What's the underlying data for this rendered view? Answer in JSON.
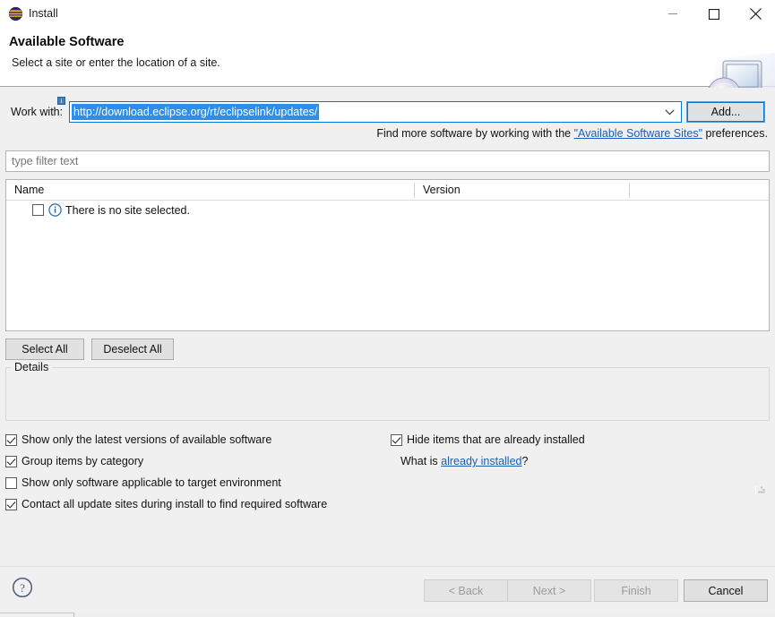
{
  "window": {
    "title": "Install",
    "icon": "eclipse-icon",
    "controls": {
      "minimize": "minimize-icon",
      "maximize": "maximize-icon",
      "close": "close-icon"
    }
  },
  "banner": {
    "title": "Available Software",
    "subtitle": "Select a site or enter the location of a site.",
    "graphic": "install-monitor-disc-graphic"
  },
  "work_with": {
    "label": "Work with:",
    "value": "http://download.eclipse.org/rt/eclipselink/updates/",
    "selected": true,
    "add_button": "Add...",
    "decoration_icon": "info-decoration-icon"
  },
  "find_more": {
    "prefix": "Find more software by working with the ",
    "link": "\"Available Software Sites\"",
    "suffix": " preferences."
  },
  "filter": {
    "placeholder": "type filter text",
    "value": ""
  },
  "table": {
    "columns": [
      "Name",
      "Version"
    ],
    "rows": [
      {
        "checked": false,
        "icon": "info-icon",
        "name": "There is no site selected.",
        "version": ""
      }
    ]
  },
  "select_buttons": {
    "select_all": "Select All",
    "deselect_all": "Deselect All"
  },
  "details": {
    "label": "Details",
    "content": ""
  },
  "options_left": [
    {
      "label": "Show only the latest versions of available software",
      "checked": true
    },
    {
      "label": "Group items by category",
      "checked": true
    },
    {
      "label": "Show only software applicable to target environment",
      "checked": false
    },
    {
      "label": "Contact all update sites during install to find required software",
      "checked": true
    }
  ],
  "options_right": [
    {
      "label": "Hide items that are already installed",
      "checked": true
    }
  ],
  "what_is": {
    "prefix": "What is ",
    "link": "already installed",
    "suffix": "?"
  },
  "footer": {
    "help_icon": "help-icon",
    "buttons": [
      {
        "label": "< Back",
        "enabled": false
      },
      {
        "label": "Next >",
        "enabled": false
      },
      {
        "label": "Finish",
        "enabled": false
      },
      {
        "label": "Cancel",
        "enabled": true
      }
    ]
  },
  "colors": {
    "accent": "#0078d7",
    "selection": "#2f8ee8",
    "link": "#1a5fb4",
    "body_bg": "#f0f0f0",
    "field_bg": "#ffffff"
  }
}
